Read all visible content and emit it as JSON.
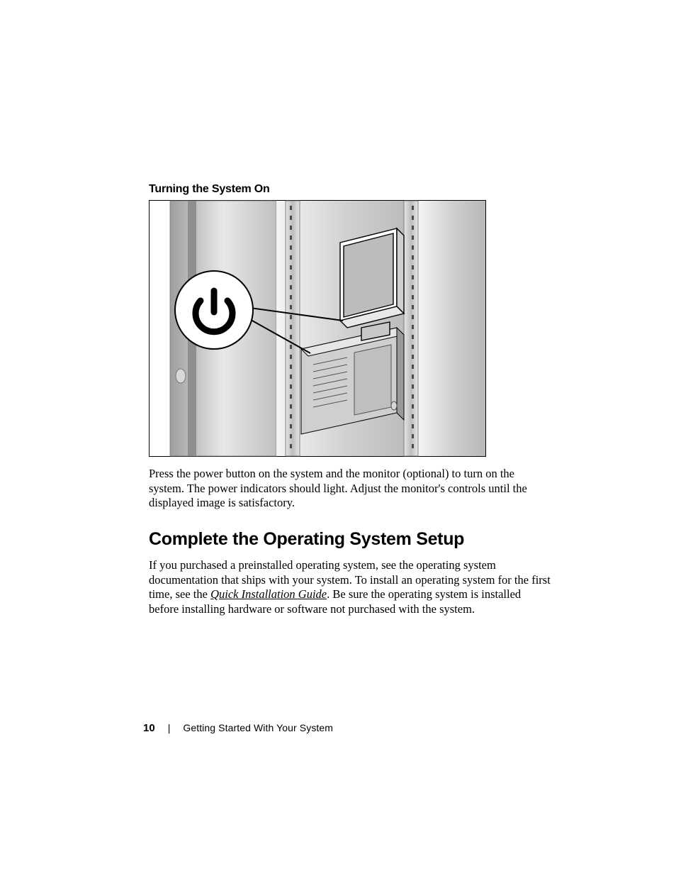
{
  "subheading": "Turning the System On",
  "caption": "Press the power button on the system and the monitor (optional) to turn on the system. The power indicators should light. Adjust the monitor's controls until the displayed image is satisfactory.",
  "heading": "Complete the Operating System Setup",
  "body_pre": "If you purchased a preinstalled operating system, see the operating system documentation that ships with your system. To install an operating system for the first time, see the ",
  "body_ital": "Quick Installation Guide",
  "body_post": ". Be sure the operating system is installed before installing hardware or software not purchased with the system.",
  "footer": {
    "page": "10",
    "sep": "|",
    "title": "Getting Started With Your System"
  },
  "figure_alt": "Illustration of a rack-mounted server with a monitor; a callout circle highlights the power button icon."
}
